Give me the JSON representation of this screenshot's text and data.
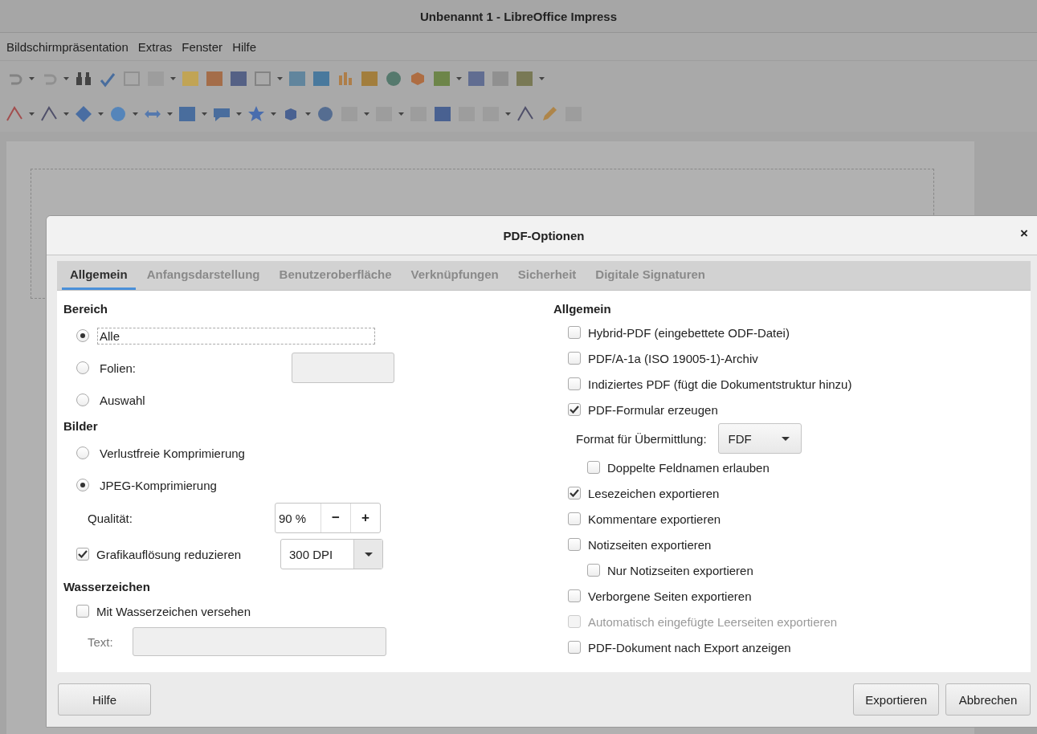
{
  "window": {
    "title": "Unbenannt 1 - LibreOffice Impress"
  },
  "menu": [
    "Bildschirmpräsentation",
    "Extras",
    "Fenster",
    "Hilfe"
  ],
  "dialog": {
    "title": "PDF-Optionen",
    "close": "×",
    "tabs": [
      {
        "label": "Allgemein",
        "selected": true
      },
      {
        "label": "Anfangsdarstellung",
        "selected": false
      },
      {
        "label": "Benutzeroberfläche",
        "selected": false
      },
      {
        "label": "Verknüpfungen",
        "selected": false
      },
      {
        "label": "Sicherheit",
        "selected": false
      },
      {
        "label": "Digitale Signaturen",
        "selected": false
      }
    ],
    "range": {
      "heading": "Bereich",
      "options": [
        {
          "label": "Alle",
          "selected": true,
          "focused": true,
          "kind": "plain"
        },
        {
          "label": "Folien:",
          "selected": false,
          "focused": false,
          "kind": "field"
        },
        {
          "label": "Auswahl",
          "selected": false,
          "focused": false,
          "kind": "plain"
        }
      ]
    },
    "images": {
      "heading": "Bilder",
      "options": [
        {
          "label": "Verlustfreie Komprimierung",
          "selected": false
        },
        {
          "label": "JPEG-Komprimierung",
          "selected": true
        }
      ],
      "quality": {
        "label": "Qualität:",
        "value": "90 %",
        "minus": "−",
        "plus": "+"
      },
      "reduce": {
        "label": "Grafikauflösung reduzieren",
        "checked": true,
        "value": "300 DPI"
      }
    },
    "watermark": {
      "heading": "Wasserzeichen",
      "checkbox": {
        "label": "Mit Wasserzeichen versehen",
        "checked": false
      },
      "text_label": "Text:"
    },
    "general": {
      "heading": "Allgemein",
      "items": [
        {
          "kind": "checkbox",
          "label": "Hybrid-PDF (eingebettete ODF-Datei)",
          "checked": false,
          "disabled": false
        },
        {
          "kind": "checkbox",
          "label": "PDF/A-1a (ISO 19005-1)-Archiv",
          "checked": false,
          "disabled": false
        },
        {
          "kind": "checkbox",
          "label": "Indiziertes PDF (fügt die Dokumentstruktur hinzu)",
          "checked": false,
          "disabled": false
        },
        {
          "kind": "checkbox",
          "label": "PDF-Formular erzeugen",
          "checked": true,
          "disabled": false,
          "children": [
            {
              "kind": "select",
              "label": "Format für Übermittlung:",
              "value": "FDF"
            },
            {
              "kind": "checkbox",
              "label": "Doppelte Feldnamen erlauben",
              "checked": false,
              "disabled": false
            }
          ]
        },
        {
          "kind": "checkbox",
          "label": "Lesezeichen exportieren",
          "checked": true,
          "disabled": false
        },
        {
          "kind": "checkbox",
          "label": "Kommentare exportieren",
          "checked": false,
          "disabled": false
        },
        {
          "kind": "checkbox",
          "label": "Notizseiten exportieren",
          "checked": false,
          "disabled": false,
          "children": [
            {
              "kind": "checkbox",
              "label": "Nur Notizseiten exportieren",
              "checked": false,
              "disabled": false
            }
          ]
        },
        {
          "kind": "checkbox",
          "label": "Verborgene Seiten exportieren",
          "checked": false,
          "disabled": false
        },
        {
          "kind": "checkbox",
          "label": "Automatisch eingefügte Leerseiten exportieren",
          "checked": false,
          "disabled": true
        },
        {
          "kind": "checkbox",
          "label": "PDF-Dokument nach Export anzeigen",
          "checked": false,
          "disabled": false
        }
      ]
    },
    "buttons": {
      "help": "Hilfe",
      "export": "Exportieren",
      "cancel": "Abbrechen"
    }
  }
}
